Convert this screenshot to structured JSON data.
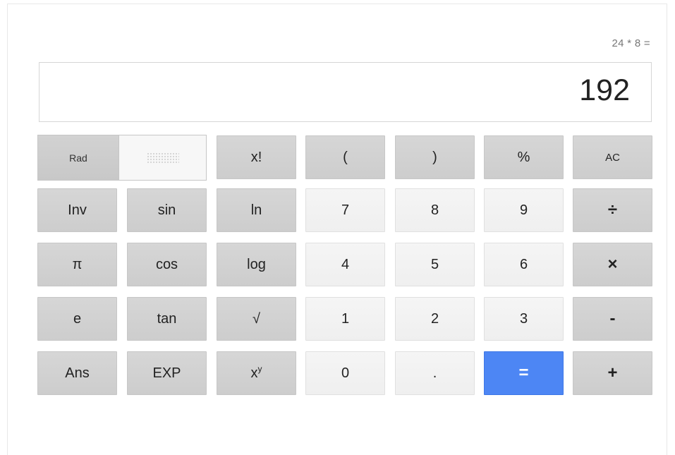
{
  "expression": "24 * 8 =",
  "display_value": "192",
  "mode_toggle": {
    "rad_label": "Rad",
    "deg_icon": "dotted-grid-icon"
  },
  "buttons": {
    "factorial": "x!",
    "open_paren": "(",
    "close_paren": ")",
    "percent": "%",
    "clear": "AC",
    "inv": "Inv",
    "sin": "sin",
    "ln": "ln",
    "seven": "7",
    "eight": "8",
    "nine": "9",
    "divide": "÷",
    "pi": "π",
    "cos": "cos",
    "log": "log",
    "four": "4",
    "five": "5",
    "six": "6",
    "multiply": "×",
    "e": "e",
    "tan": "tan",
    "sqrt": "√",
    "one": "1",
    "two": "2",
    "three": "3",
    "minus": "-",
    "ans": "Ans",
    "exp": "EXP",
    "power_base": "x",
    "power_exp": "y",
    "zero": "0",
    "dot": ".",
    "equals": "=",
    "plus": "+"
  },
  "colors": {
    "accent_equals": "#4d86f4",
    "function_key": "#d0d0d0",
    "digit_key": "#f2f2f2"
  }
}
